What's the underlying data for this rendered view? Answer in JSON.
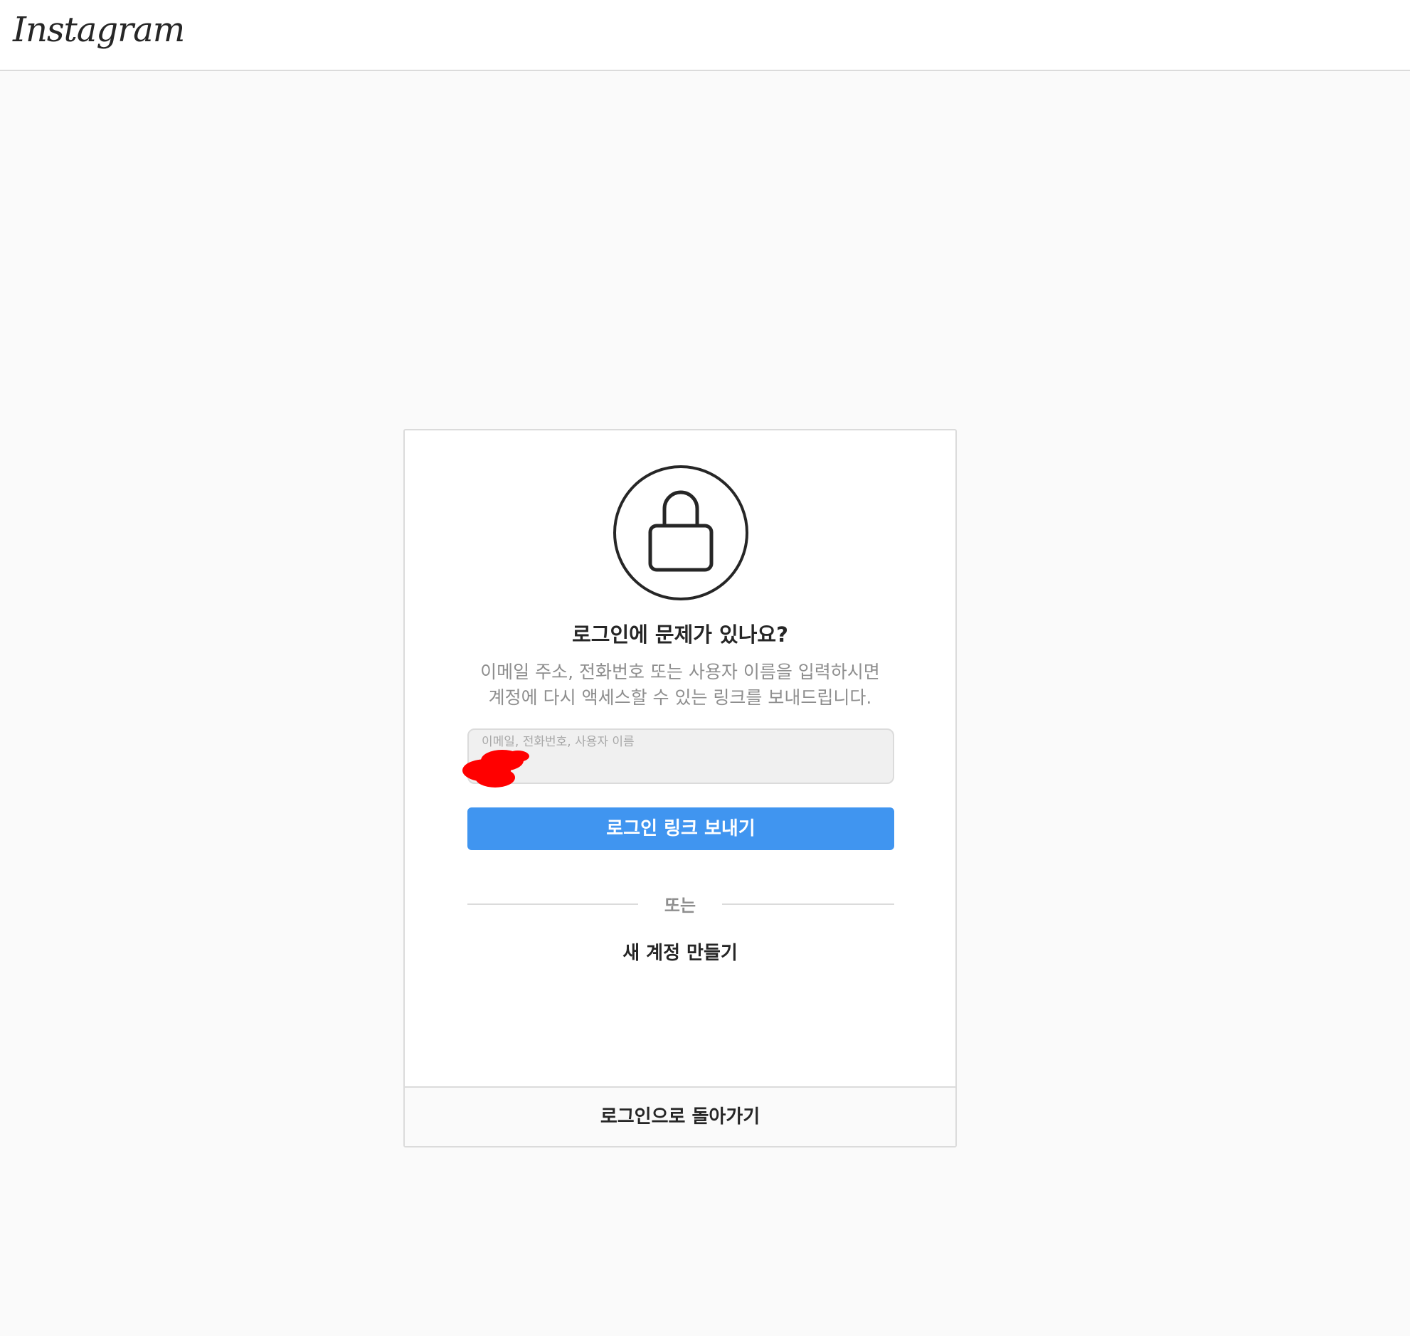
{
  "header": {
    "logo_text": "Instagram"
  },
  "card": {
    "icon": "lock-icon",
    "title": "로그인에 문제가 있나요?",
    "description_line1": "이메일 주소, 전화번호 또는 사용자 이름을 입력하시면",
    "description_line2": "계정에 다시 액세스할 수 있는 링크를 보내드립니다.",
    "input": {
      "label": "이메일, 전화번호, 사용자 이름",
      "value": ""
    },
    "send_button_label": "로그인 링크 보내기",
    "divider_text": "또는",
    "create_account_label": "새 계정 만들기",
    "back_to_login_label": "로그인으로 돌아가기"
  },
  "colors": {
    "primary_button": "#4095f0",
    "page_background": "#fafafa",
    "border": "#dbdbdb",
    "muted_text": "#8e8e8e",
    "redaction": "#ff0000"
  }
}
